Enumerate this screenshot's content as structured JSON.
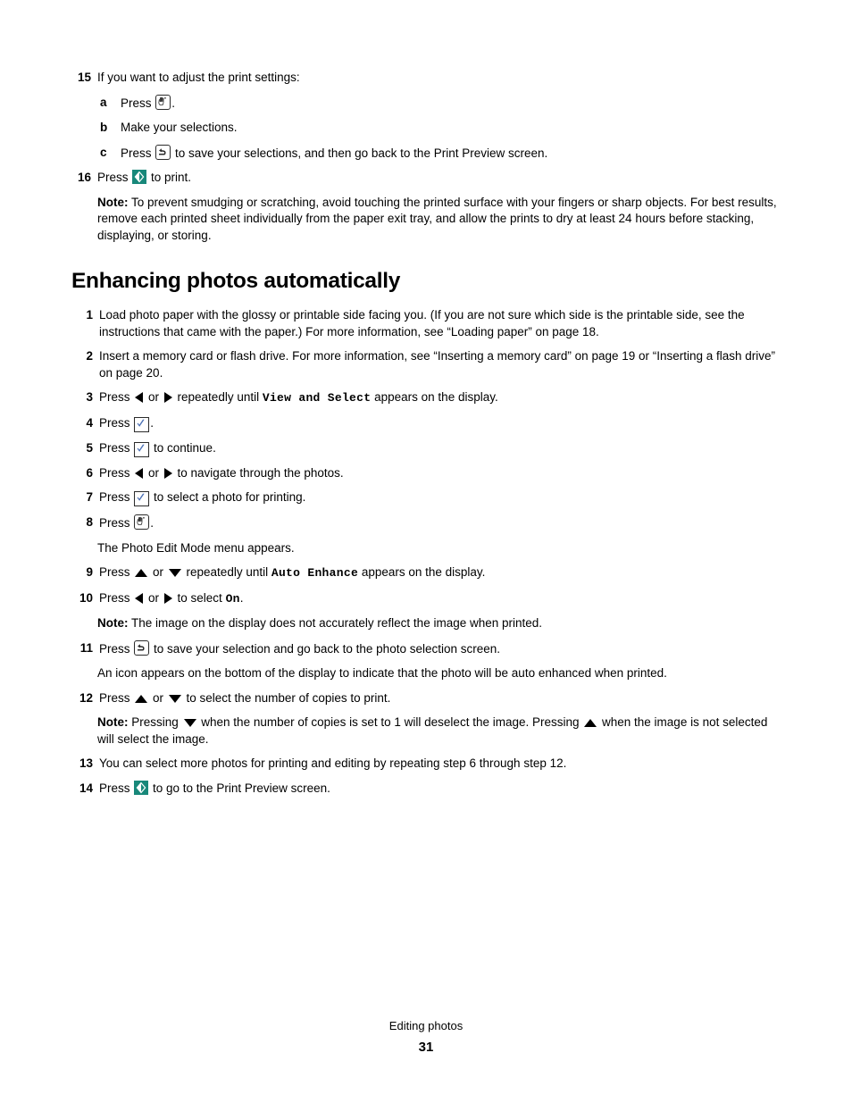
{
  "document": {
    "footer_label": "Editing photos",
    "page_number": "31"
  },
  "colors": {
    "print_button": "#18887a",
    "checkmark": "#4a6fb5",
    "text": "#000000"
  },
  "top_steps": [
    {
      "number": "15",
      "text": "If you want to adjust the print settings:",
      "substeps": [
        {
          "letter": "a",
          "pre": "Press ",
          "icon": "menu-icon",
          "post": "."
        },
        {
          "letter": "b",
          "pre": "Make your selections.",
          "icon": "",
          "post": ""
        },
        {
          "letter": "c",
          "pre": "Press ",
          "icon": "back-icon",
          "post": " to save your selections, and then go back to the Print Preview screen."
        }
      ]
    },
    {
      "number": "16",
      "pre": "Press ",
      "icon": "print-select-icon",
      "post": " to print."
    }
  ],
  "top_note": {
    "label": "Note:",
    "text": " To prevent smudging or scratching, avoid touching the printed surface with your fingers or sharp objects. For best results, remove each printed sheet individually from the paper exit tray, and allow the prints to dry at least 24 hours before stacking, displaying, or storing."
  },
  "heading": "Enhancing photos automatically",
  "steps": [
    {
      "number": "1",
      "text": "Load photo paper with the glossy or printable side facing you. (If you are not sure which side is the printable side, see the instructions that came with the paper.) For more information, see “Loading paper” on page 18."
    },
    {
      "number": "2",
      "text": "Insert a memory card or flash drive. For more information, see “Inserting a memory card” on page 19 or “Inserting a flash drive” on page 20."
    },
    {
      "number": "3",
      "part1": "Press ",
      "part2": " or ",
      "part3": " repeatedly until ",
      "mono": "View and Select",
      "part4": " appears on the display."
    },
    {
      "number": "4",
      "part1": "Press ",
      "part4": "."
    },
    {
      "number": "5",
      "part1": "Press ",
      "part4": " to continue."
    },
    {
      "number": "6",
      "part1": "Press ",
      "part2": " or ",
      "part4": " to navigate through the photos."
    },
    {
      "number": "7",
      "part1": "Press ",
      "part4": " to select a photo for printing."
    },
    {
      "number": "8",
      "part1": "Press ",
      "part4": "."
    },
    {
      "number": "9",
      "part1": "Press ",
      "part2": " or ",
      "part3": " repeatedly until ",
      "mono": "Auto Enhance",
      "part4": " appears on the display."
    },
    {
      "number": "10",
      "part1": "Press ",
      "part2": " or ",
      "part3": " to select ",
      "mono": "On",
      "part4": "."
    },
    {
      "number": "11",
      "part1": "Press ",
      "part4": " to save your selection and go back to the photo selection screen."
    },
    {
      "number": "12",
      "part1": "Press ",
      "part2": " or ",
      "part4": " to select the number of copies to print."
    },
    {
      "number": "13",
      "text": "You can select more photos for printing and editing by repeating step 6 through step 12."
    },
    {
      "number": "14",
      "part1": "Press ",
      "part4": " to go to the Print Preview screen."
    }
  ],
  "body_text": {
    "after_step8": "The Photo Edit Mode menu appears.",
    "after_step11": "An icon appears on the bottom of the display to indicate that the photo will be auto enhanced when printed."
  },
  "notes": {
    "after_step10_label": "Note:",
    "after_step10_text": " The image on the display does not accurately reflect the image when printed.",
    "after_step12_label": "Note:",
    "after_step12_part1": " Pressing ",
    "after_step12_part2": " when the number of copies is set to 1 will deselect the image. Pressing ",
    "after_step12_part3": " when the image is not selected will select the image."
  }
}
